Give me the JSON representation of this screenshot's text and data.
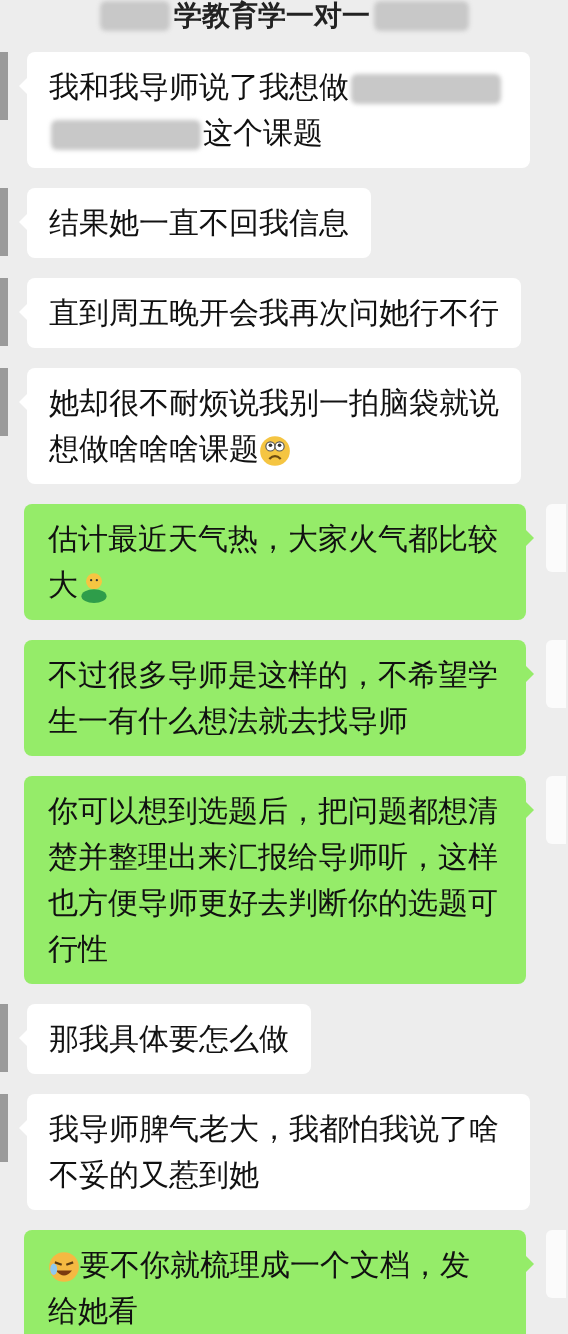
{
  "chat_title": {
    "text": "学教育学一对一"
  },
  "messages": [
    {
      "outgoing": false,
      "lines": [
        [
          {
            "kind": "text",
            "text": "我和我导师说了我想做"
          },
          {
            "kind": "redacted"
          },
          {
            "kind": "redacted"
          },
          {
            "kind": "text",
            "text": "这个课题"
          }
        ]
      ]
    },
    {
      "outgoing": false,
      "lines": [
        [
          {
            "kind": "text",
            "text": "结果她一直不回我信息"
          }
        ]
      ]
    },
    {
      "outgoing": false,
      "lines": [
        [
          {
            "kind": "text",
            "text": "直到周五晚开会我再次问她行不行"
          }
        ]
      ]
    },
    {
      "outgoing": false,
      "lines": [
        [
          {
            "kind": "text",
            "text": "她却很不耐烦说我别一拍脑袋就说"
          }
        ],
        [
          {
            "kind": "text",
            "text": "想做啥啥啥课题"
          },
          {
            "kind": "frown"
          }
        ]
      ]
    },
    {
      "outgoing": true,
      "lines": [
        [
          {
            "kind": "text",
            "text": "估计最近天气热，大家火气都比较"
          }
        ],
        [
          {
            "kind": "text",
            "text": "大"
          },
          {
            "kind": "hug"
          }
        ]
      ]
    },
    {
      "outgoing": true,
      "lines": [
        [
          {
            "kind": "text",
            "text": "不过很多导师是这样的，不希望学生一有什么想法就去找导师"
          }
        ]
      ]
    },
    {
      "outgoing": true,
      "lines": [
        [
          {
            "kind": "text",
            "text": "你可以想到选题后，把问题都想清楚并整理出来汇报给导师听，这样也方便导师更好去判断你的选题可行性"
          }
        ]
      ]
    },
    {
      "outgoing": false,
      "lines": [
        [
          {
            "kind": "text",
            "text": "那我具体要怎么做"
          }
        ]
      ]
    },
    {
      "outgoing": false,
      "lines": [
        [
          {
            "kind": "text",
            "text": "我导师脾气老大，我都怕我说了啥不妥的又惹到她"
          }
        ]
      ]
    },
    {
      "outgoing": true,
      "lines": [
        [
          {
            "kind": "laughcry"
          },
          {
            "kind": "text",
            "text": "要不你就梳理成一个文档，发"
          }
        ],
        [
          {
            "kind": "text",
            "text": "给她看"
          }
        ]
      ]
    }
  ]
}
